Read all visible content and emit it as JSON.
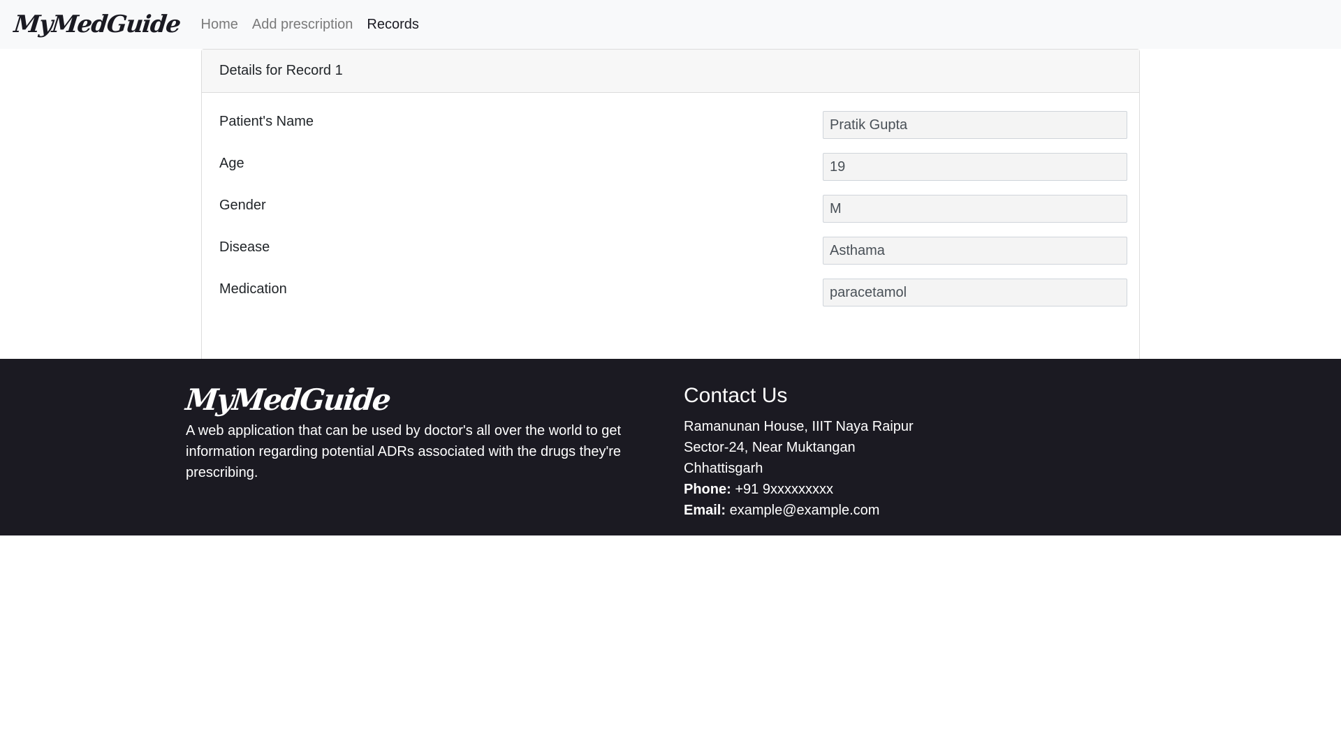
{
  "navbar": {
    "brand": "MyMedGuide",
    "links": [
      {
        "label": "Home",
        "active": false
      },
      {
        "label": "Add prescription",
        "active": false
      },
      {
        "label": "Records",
        "active": true
      }
    ]
  },
  "record": {
    "header": "Details for Record 1",
    "fields": [
      {
        "label": "Patient's Name",
        "value": "Pratik Gupta"
      },
      {
        "label": "Age",
        "value": "19"
      },
      {
        "label": "Gender",
        "value": "M"
      },
      {
        "label": "Disease",
        "value": "Asthama"
      },
      {
        "label": "Medication",
        "value": "paracetamol"
      }
    ]
  },
  "footer": {
    "brand": "MyMedGuide",
    "description": "A web application that can be used by doctor's all over the world to get information regarding potential ADRs associated with the drugs they're prescribing.",
    "contact": {
      "title": "Contact Us",
      "address_line1": "Ramanunan House, IIIT Naya Raipur",
      "address_line2": "Sector-24, Near Muktangan",
      "address_line3": "Chhattisgarh",
      "phone_label": "Phone:",
      "phone_value": "+91 9xxxxxxxxx",
      "email_label": "Email:",
      "email_value": "example@example.com"
    }
  },
  "colors": {
    "navbar_bg": "#f8f9fa",
    "footer_bg": "#1b1a22",
    "nav_link": "#7a7a7a",
    "nav_link_active": "#1a1a22"
  }
}
